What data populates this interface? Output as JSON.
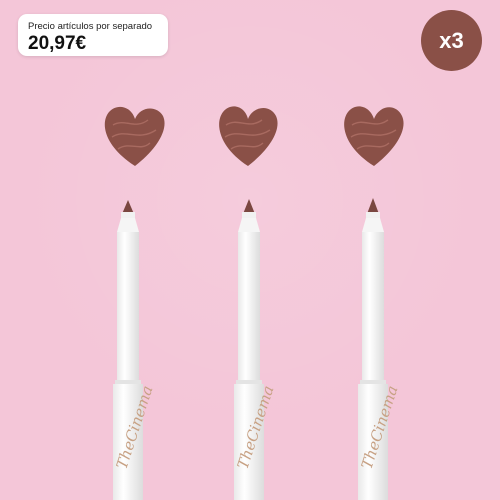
{
  "price_badge": {
    "label": "Precio artículos por separado",
    "value": "20,97€"
  },
  "quantity_badge": {
    "text": "x3"
  },
  "product": {
    "brand_lettering": "TheCinema",
    "pencil_count": 3
  },
  "colors": {
    "background": "#f4c6d8",
    "swatch": "#8a5047",
    "badge": "#8a5047",
    "pencil_body": "#ffffff"
  }
}
